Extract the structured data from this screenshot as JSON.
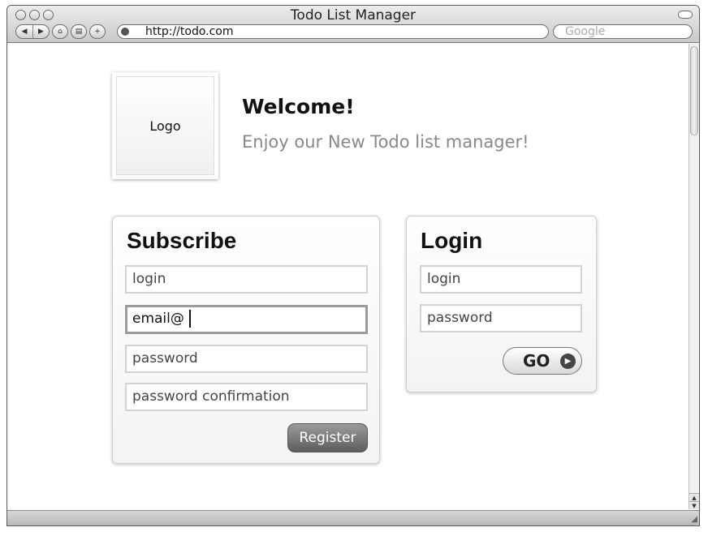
{
  "browser": {
    "window_title": "Todo List Manager",
    "url": "http://todo.com",
    "search_placeholder": "Google",
    "nav_icons": [
      "back-icon",
      "forward-icon",
      "home-icon",
      "print-icon",
      "add-bookmark-icon"
    ]
  },
  "header": {
    "logo_label": "Logo",
    "welcome_title": "Welcome!",
    "welcome_subtitle": "Enjoy our New Todo list manager!"
  },
  "subscribe": {
    "title": "Subscribe",
    "login_placeholder": "login",
    "email_value": "email@",
    "password_placeholder": "password",
    "password_confirmation_placeholder": "password confirmation",
    "register_label": "Register"
  },
  "login": {
    "title": "Login",
    "login_placeholder": "login",
    "password_placeholder": "password",
    "go_label": "GO"
  },
  "colors": {
    "subtitle_gray": "#888888",
    "register_button": "#6e6e6e",
    "focused_border": "#9b9b9b"
  }
}
